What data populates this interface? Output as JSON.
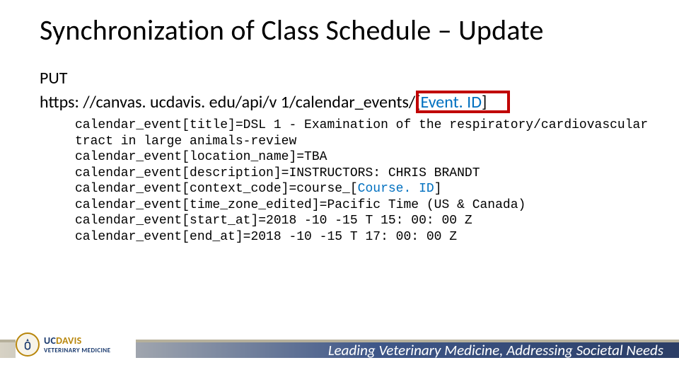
{
  "title": "Synchronization of Class Schedule – Update",
  "method": "PUT",
  "url": {
    "base": "https: //canvas. ucdavis. edu/api/v 1/calendar_events/[",
    "event_id": "Event. ID",
    "close": "]"
  },
  "params": {
    "line1": "calendar_event[title]=DSL 1 - Examination of the respiratory/cardiovascular",
    "line2": "tract in large animals-review",
    "line3": "calendar_event[location_name]=TBA",
    "line4": "calendar_event[description]=INSTRUCTORS: CHRIS BRANDT",
    "line5a": "calendar_event[context_code]=course_[",
    "course_id": "Course. ID",
    "line5b": "]",
    "line6": "calendar_event[time_zone_edited]=Pacific Time (US & Canada)",
    "line7": "calendar_event[start_at]=2018 -10 -15 T 15: 00: 00 Z",
    "line8": "calendar_event[end_at]=2018 -10 -15 T 17: 00: 00 Z"
  },
  "footer": {
    "logo_top": "UC",
    "logo_davis": "DAVIS",
    "logo_sub": "VETERINARY MEDICINE",
    "tagline": "Leading Veterinary Medicine, Addressing Societal Needs"
  }
}
